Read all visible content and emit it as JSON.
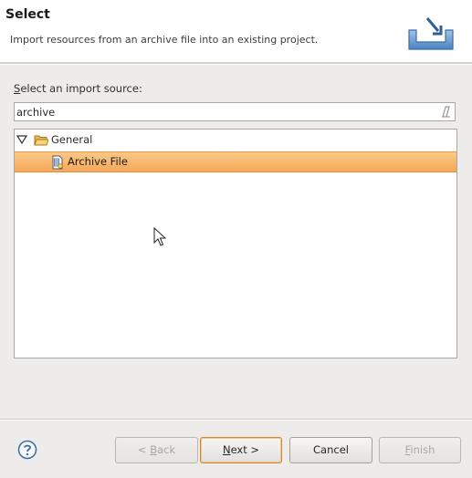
{
  "header": {
    "title": "Select",
    "description": "Import resources from an archive file into an existing project.",
    "icon": "import-wizard-icon"
  },
  "source": {
    "label_mnemonic": "S",
    "label_rest": "elect an import source:",
    "filter_value": "archive"
  },
  "tree": {
    "category": {
      "label": "General",
      "expanded": true,
      "icon": "folder-open-icon"
    },
    "item": {
      "label": "Archive File",
      "selected": true,
      "icon": "archive-file-icon"
    }
  },
  "buttons": {
    "back": {
      "prefix": "< ",
      "mnemonic": "B",
      "rest": "ack",
      "enabled": false
    },
    "next": {
      "mnemonic": "N",
      "rest": "ext >",
      "enabled": true
    },
    "cancel": {
      "label": "Cancel",
      "enabled": true
    },
    "finish": {
      "mnemonic": "F",
      "rest": "inish",
      "enabled": false
    }
  },
  "colors": {
    "selection": "#f5a85a",
    "background": "#edeceb"
  }
}
